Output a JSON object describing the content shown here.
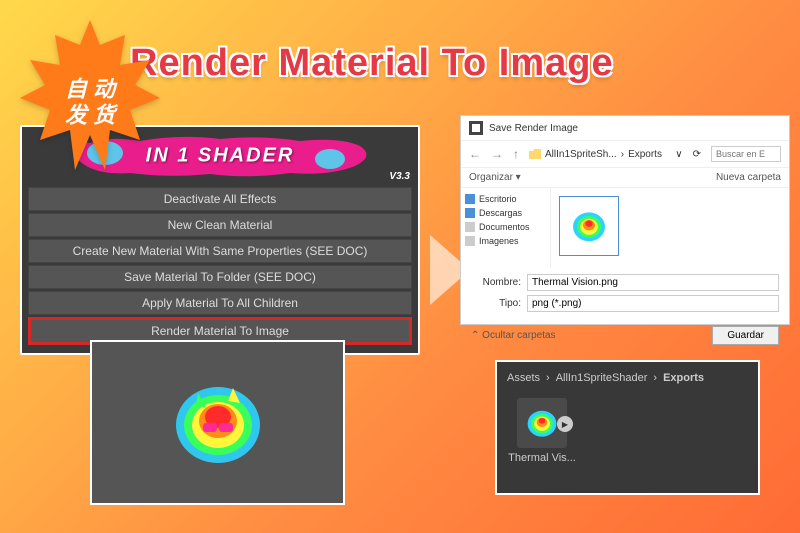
{
  "badge": {
    "line1": "自 动",
    "line2": "发 货"
  },
  "title": "Render Material To Image",
  "shader_panel": {
    "logo_text": "IN 1 SHADER",
    "version": "V3.3",
    "items": [
      "Deactivate All Effects",
      "New Clean Material",
      "Create New Material With Same Properties (SEE DOC)",
      "Save Material To Folder (SEE DOC)",
      "Apply Material To All Children",
      "Render Material To Image"
    ],
    "highlighted_index": 5
  },
  "save_dialog": {
    "title": "Save Render Image",
    "breadcrumb": [
      "AllIn1SpriteSh...",
      "Exports"
    ],
    "search_placeholder": "Buscar en E",
    "organize": "Organizar",
    "new_folder": "Nueva carpeta",
    "sidebar": [
      {
        "label": "Escritorio",
        "color": "#4a90d9"
      },
      {
        "label": "Descargas",
        "color": "#4a90d9"
      },
      {
        "label": "Documentos",
        "color": "#888"
      },
      {
        "label": "Imagenes",
        "color": "#888"
      }
    ],
    "filename_label": "Nombre:",
    "filename_value": "Thermal Vision.png",
    "type_label": "Tipo:",
    "type_value": "png (*.png)",
    "collapse": "Ocultar carpetas",
    "save_button": "Guardar"
  },
  "unity_panel": {
    "crumb": [
      "Assets",
      "AllIn1SpriteShader",
      "Exports"
    ],
    "item_label": "Thermal Vis..."
  }
}
